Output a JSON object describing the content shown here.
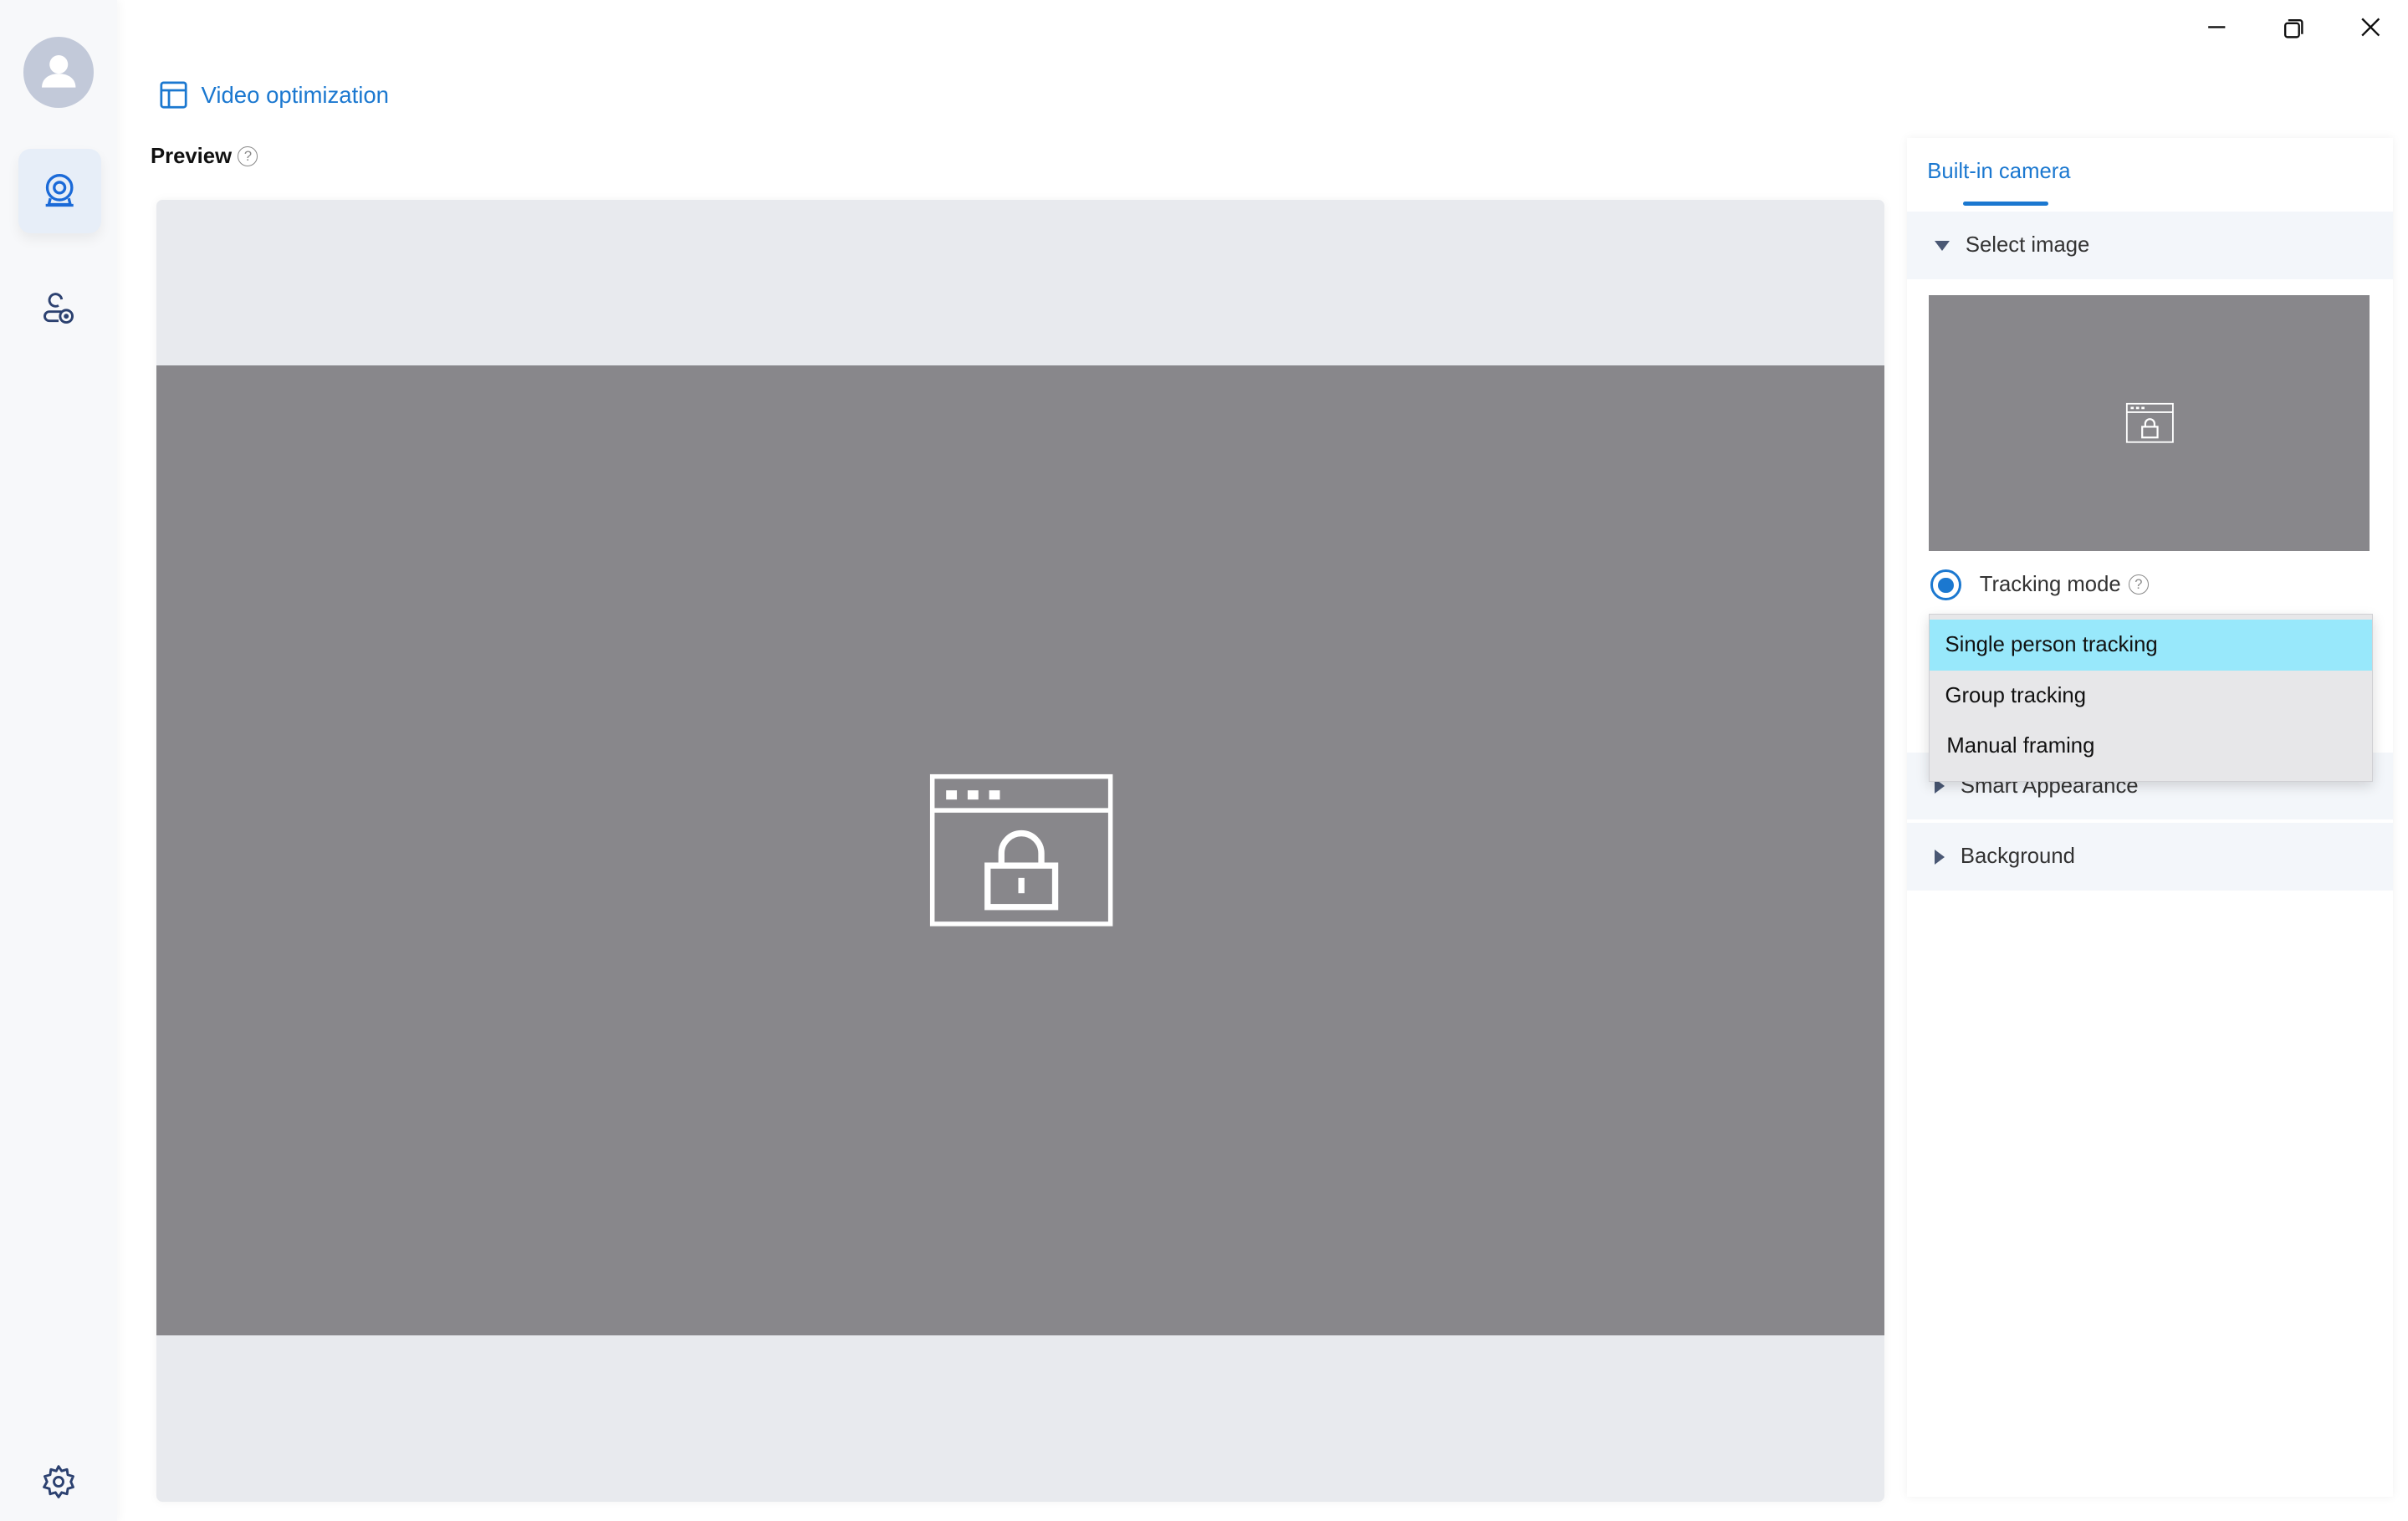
{
  "window": {
    "controls": [
      "minimize",
      "restore",
      "close"
    ]
  },
  "sidebar": {
    "items": [
      {
        "name": "avatar"
      },
      {
        "name": "camera",
        "active": true
      },
      {
        "name": "user-camera"
      },
      {
        "name": "settings"
      }
    ]
  },
  "header": {
    "title": "Video optimization",
    "title_icon": "layout-icon"
  },
  "preview": {
    "label": "Preview",
    "help": "?",
    "placeholder_icon": "locked-window-icon"
  },
  "right_panel": {
    "tab": "Built-in camera",
    "sections": {
      "select_image": "Select image",
      "smart_appearance": "Smart Appearance",
      "background": "Background"
    },
    "tracking_mode": {
      "label": "Tracking mode",
      "help": "?",
      "enabled": true
    },
    "dropdown": {
      "options": [
        "Single person tracking",
        "Group tracking",
        "Manual framing"
      ],
      "selected": "Single person tracking"
    }
  },
  "colors": {
    "accent": "#1b78d0",
    "selected_option": "#98e8fb",
    "video_bg": "#88878b"
  }
}
